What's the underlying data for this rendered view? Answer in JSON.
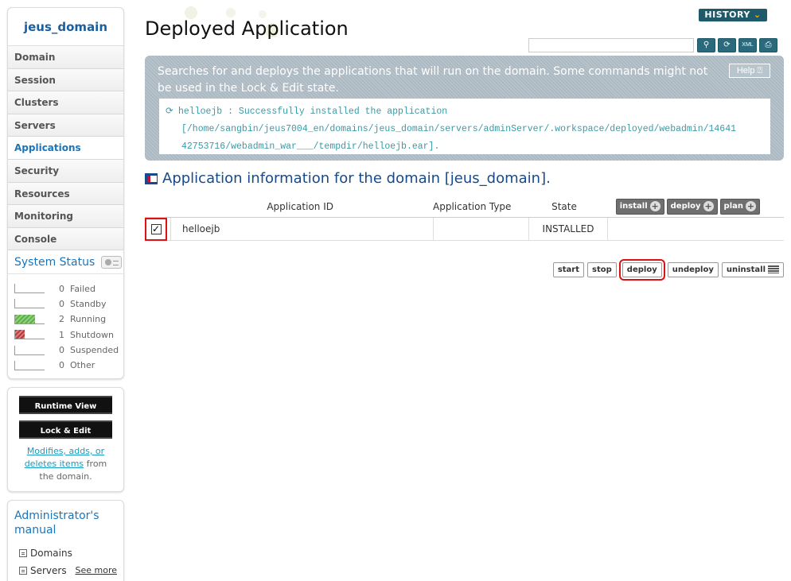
{
  "sidebar": {
    "domain": "jeus_domain",
    "nav": [
      "Domain",
      "Session",
      "Clusters",
      "Servers",
      "Applications",
      "Security",
      "Resources",
      "Monitoring",
      "Console"
    ],
    "active_index": 4,
    "status_title": "System Status",
    "status": [
      {
        "count": "0",
        "label": "Failed",
        "fill": 0,
        "color": "none"
      },
      {
        "count": "0",
        "label": "Standby",
        "fill": 0,
        "color": "none"
      },
      {
        "count": "2",
        "label": "Running",
        "fill": 0.67,
        "color": "green"
      },
      {
        "count": "1",
        "label": "Shutdown",
        "fill": 0.33,
        "color": "red"
      },
      {
        "count": "0",
        "label": "Suspended",
        "fill": 0,
        "color": "none"
      },
      {
        "count": "0",
        "label": "Other",
        "fill": 0,
        "color": "none"
      }
    ],
    "runtime_view": "Runtime View",
    "lock_edit": "Lock & Edit",
    "modify_link1": "Modifies, adds, or",
    "modify_link2": "deletes items",
    "modify_rest1": " from",
    "modify_rest2": "the domain.",
    "manual_title": "Administrator's manual",
    "manual_items": [
      "Domains",
      "Servers"
    ],
    "see_more": "See more"
  },
  "header": {
    "title": "Deployed Application",
    "history": "HISTORY",
    "search_value": ""
  },
  "banner": {
    "text": "Searches for and deploys the applications that will run on the domain. Some commands might not be used in the Lock & Edit state.",
    "help": "Help",
    "log_lines": [
      "helloejb : Successfully installed the application",
      "[/home/sangbin/jeus7004_en/domains/jeus_domain/servers/adminServer/.workspace/deployed/webadmin/14641",
      "42753716/webadmin_war___/tempdir/helloejb.ear]."
    ]
  },
  "section": {
    "title": "Application information for the domain [jeus_domain]."
  },
  "table": {
    "headers": {
      "id": "Application ID",
      "type": "Application Type",
      "state": "State"
    },
    "header_buttons": [
      "install",
      "deploy",
      "plan"
    ],
    "rows": [
      {
        "checked": true,
        "id": "helloejb",
        "type": "",
        "state": "INSTALLED"
      }
    ]
  },
  "actions": [
    "start",
    "stop",
    "deploy",
    "undeploy",
    "uninstall"
  ],
  "colors": {
    "accent": "#1a75bb",
    "highlight": "#dd1111",
    "banner": "#b1bec6"
  }
}
